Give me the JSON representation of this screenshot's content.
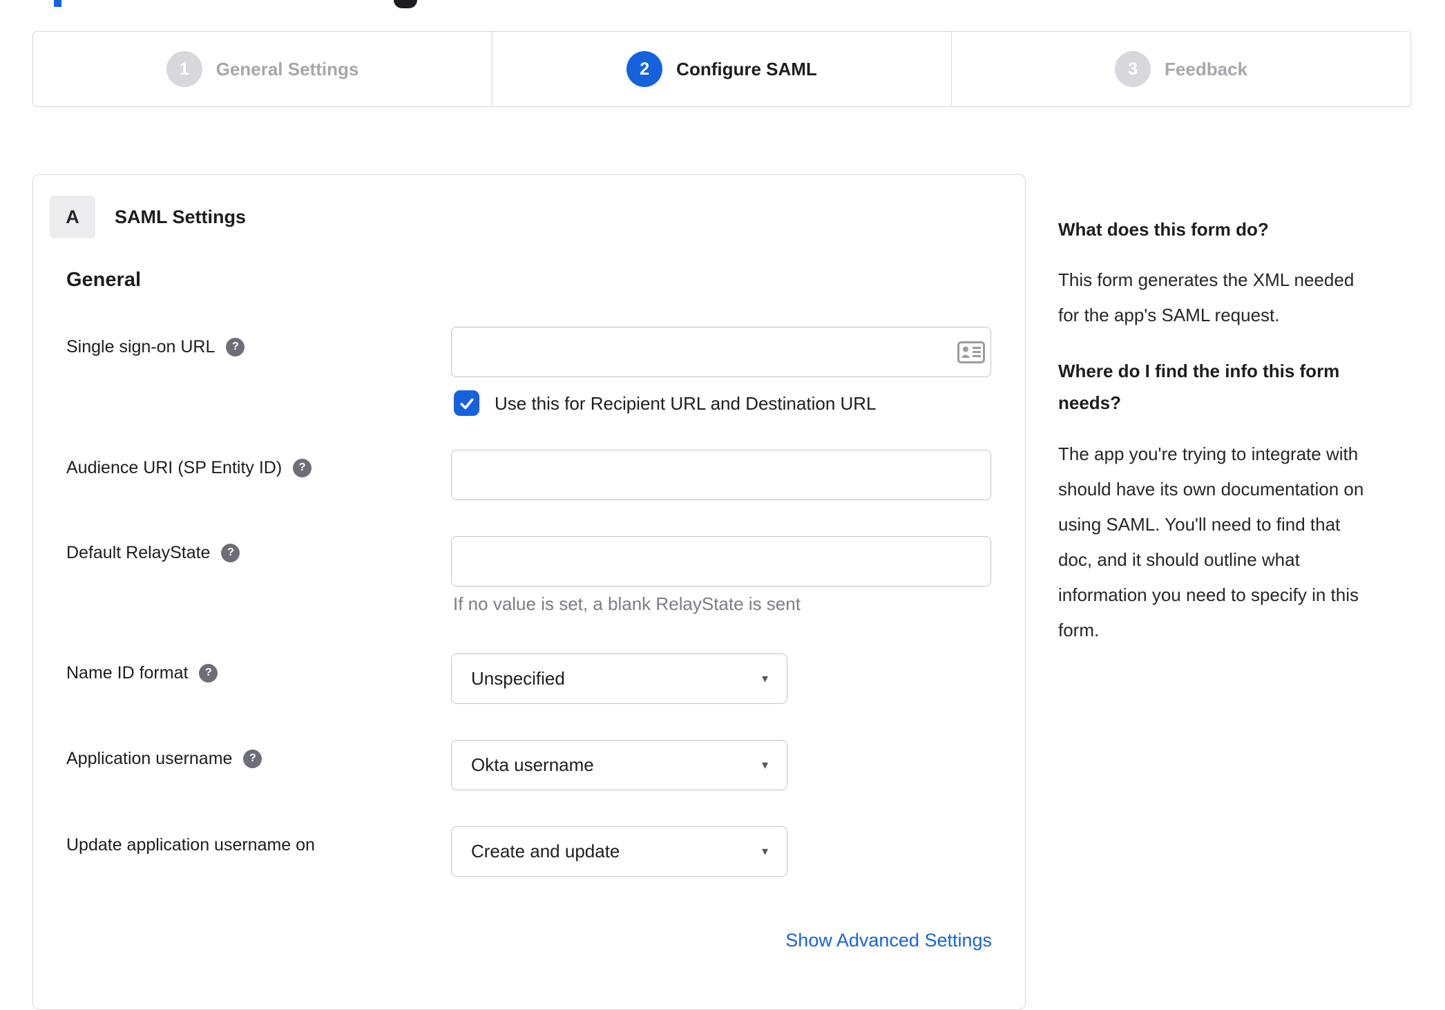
{
  "accent_color": "#1662dd",
  "icons": {
    "help_glyph": "?",
    "caret_glyph": "▼"
  },
  "stepper": {
    "steps": [
      {
        "number": "1",
        "label": "General Settings",
        "state": "inactive"
      },
      {
        "number": "2",
        "label": "Configure SAML",
        "state": "active"
      },
      {
        "number": "3",
        "label": "Feedback",
        "state": "inactive"
      }
    ]
  },
  "panel": {
    "badge": "A",
    "title": "SAML Settings",
    "section_heading": "General",
    "fields": {
      "sso": {
        "label": "Single sign-on URL",
        "value": "",
        "checkbox_label": "Use this for Recipient URL and Destination URL",
        "checkbox_checked": true
      },
      "audience": {
        "label": "Audience URI (SP Entity ID)",
        "value": ""
      },
      "relay": {
        "label": "Default RelayState",
        "value": "",
        "hint": "If no value is set, a blank RelayState is sent"
      },
      "name_id": {
        "label": "Name ID format",
        "value": "Unspecified"
      },
      "app_username": {
        "label": "Application username",
        "value": "Okta username"
      },
      "update_username": {
        "label": "Update application username on",
        "value": "Create and update"
      }
    },
    "advanced_link": "Show Advanced Settings"
  },
  "sidebar": {
    "heading1": "What does this form do?",
    "body1": "This form generates the XML needed\nfor the app's SAML request.",
    "heading2": "Where do I find the info this form\nneeds?",
    "body2": "The app you're trying to integrate with\nshould have its own documentation on\nusing SAML. You'll need to find that\ndoc, and it should outline what\ninformation you need to specify in this\nform."
  }
}
